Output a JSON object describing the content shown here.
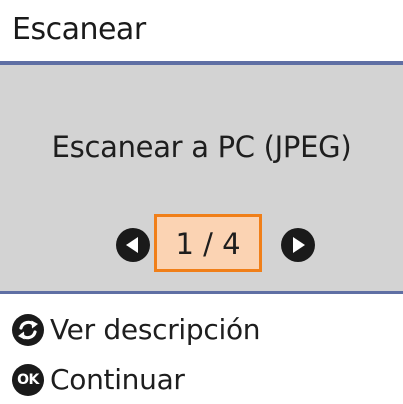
{
  "header": {
    "title": "Escanear"
  },
  "panel": {
    "option_label": "Escanear a PC (JPEG)",
    "pager": {
      "counter": "1 / 4",
      "current": 1,
      "total": 4
    }
  },
  "footer": {
    "items": [
      {
        "icon": "rotate-arrows-icon",
        "label": "Ver descripción"
      },
      {
        "icon": "ok-button-icon",
        "glyph": "OK",
        "label": "Continuar"
      }
    ]
  },
  "colors": {
    "title_rule": "#5f6fa4",
    "panel_bg": "#d3d3d3",
    "counter_bg": "#fbd3b3",
    "counter_border": "#f07f19",
    "text": "#1e1e1e",
    "button": "#1a1a1a"
  }
}
